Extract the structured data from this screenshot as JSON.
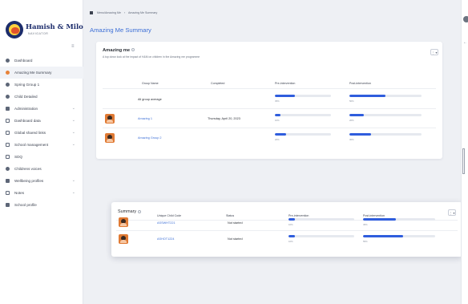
{
  "app": {
    "logo_title": "Hamish & Milo",
    "logo_subtitle": "NAVIGATOR"
  },
  "sidebar": {
    "items": [
      {
        "label": "Dashboard",
        "icon": "dashboard-icon",
        "active": false
      },
      {
        "label": "Amazing Me Summary",
        "icon": "amazing-me-icon",
        "active": true
      },
      {
        "label": "Spring Group 1",
        "icon": "group-icon",
        "active": false
      },
      {
        "label": "Child Detailed",
        "icon": "child-icon",
        "active": false
      },
      {
        "label": "Administration",
        "icon": "wrench-icon",
        "active": false,
        "expandable": true
      },
      {
        "label": "Dashboard data",
        "icon": "list-icon",
        "active": false,
        "expandable": true
      },
      {
        "label": "Global shared links",
        "icon": "list-icon",
        "active": false,
        "expandable": true
      },
      {
        "label": "School management",
        "icon": "school-icon",
        "active": false,
        "expandable": true
      },
      {
        "label": "SDQ",
        "icon": "document-icon",
        "active": false
      },
      {
        "label": "Childrens voices",
        "icon": "chat-icon",
        "active": false
      },
      {
        "label": "Wellbeing profiles",
        "icon": "grid-icon",
        "active": false,
        "expandable": true
      },
      {
        "label": "Notes",
        "icon": "note-icon",
        "active": false,
        "expandable": true
      },
      {
        "label": "School profile",
        "icon": "profile-icon",
        "active": false
      }
    ]
  },
  "breadcrumb": {
    "items": [
      "Menu/Amazing Me",
      "Amazing Me Summary"
    ]
  },
  "page": {
    "title": "Amazing Me Summary"
  },
  "amazing_me_card": {
    "title": "Amazing me",
    "subtitle": "A top down look at the impact of H&M on children in the Amazing me programme",
    "menu_label": "⋮ ▾",
    "columns": [
      "Group Name",
      "Completed",
      "Pre-intervention",
      "Post-intervention"
    ],
    "rows": [
      {
        "group": "All group average",
        "completed": "",
        "pre": 0.35,
        "pre_label": "35%",
        "post": 0.5,
        "post_label": "50%",
        "avatar": false
      },
      {
        "group": "Amazing 1",
        "completed": "Thursday, April 20, 2023",
        "pre": 0.1,
        "pre_label": "10%",
        "post": 0.2,
        "post_label": "20%",
        "avatar": true
      },
      {
        "group": "Amazing Group 2",
        "completed": "",
        "pre": 0.2,
        "pre_label": "20%",
        "post": 0.3,
        "post_label": "30%",
        "avatar": true
      }
    ]
  },
  "summary_card": {
    "title": "Summary",
    "menu_label": "⋮ ▾",
    "columns": [
      "Unique Child Code",
      "Status",
      "Pre-intervention",
      "Post-intervention"
    ],
    "rows": [
      {
        "code": "ASSWHT221",
        "status": "Not started",
        "pre": 0.1,
        "pre_label": "10%",
        "post": 0.45,
        "post_label": "45%"
      },
      {
        "code": "ASHOT1224",
        "status": "Not started",
        "pre": 0.1,
        "pre_label": "10%",
        "post": 0.55,
        "post_label": "55%"
      }
    ]
  },
  "colors": {
    "accent": "#3d6fd6",
    "bar": "#2f5ddd",
    "avatar": "#e07a34"
  }
}
